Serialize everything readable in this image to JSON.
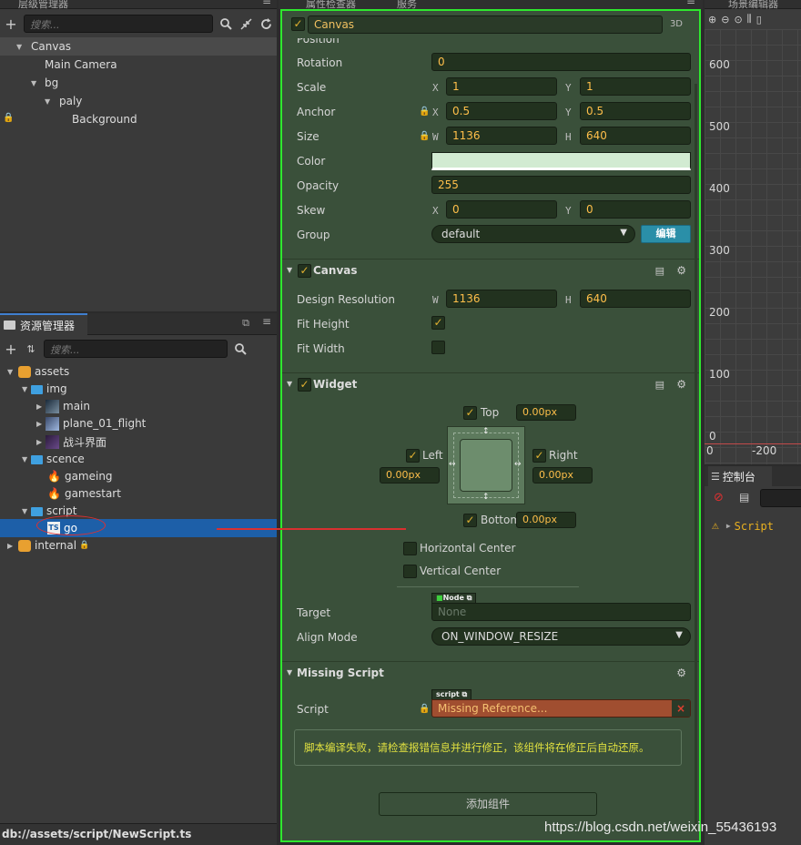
{
  "hierarchy": {
    "title": "层级管理器",
    "search_placeholder": "搜索...",
    "items": [
      "Canvas",
      "Main Camera",
      "bg",
      "paly",
      "Background"
    ]
  },
  "assets": {
    "title": "资源管理器",
    "search_placeholder": "搜索...",
    "items": [
      "assets",
      "img",
      "main",
      "plane_01_flight",
      "战斗界面",
      "scence",
      "gameing",
      "gamestart",
      "script",
      "go",
      "internal"
    ],
    "status_path": "db://assets/script/NewScript.ts"
  },
  "inspector": {
    "tab": "属性检查器",
    "tab2": "服务",
    "node_name": "Canvas",
    "badge_3d": "3D",
    "position_label": "Position",
    "rotation": {
      "label": "Rotation",
      "value": "0"
    },
    "scale": {
      "label": "Scale",
      "x_axis": "X",
      "x": "1",
      "y_axis": "Y",
      "y": "1"
    },
    "anchor": {
      "label": "Anchor",
      "x_axis": "X",
      "x": "0.5",
      "y_axis": "Y",
      "y": "0.5"
    },
    "size": {
      "label": "Size",
      "w_axis": "W",
      "w": "1136",
      "h_axis": "H",
      "h": "640"
    },
    "color": {
      "label": "Color",
      "swatch": "#d2ebd2"
    },
    "opacity": {
      "label": "Opacity",
      "value": "255"
    },
    "skew": {
      "label": "Skew",
      "x_axis": "X",
      "x": "0",
      "y_axis": "Y",
      "y": "0"
    },
    "group": {
      "label": "Group",
      "value": "default",
      "edit_button": "编辑"
    },
    "canvas_comp": {
      "title": "Canvas",
      "design_label": "Design Resolution",
      "w_axis": "W",
      "w": "1136",
      "h_axis": "H",
      "h": "640",
      "fit_height": "Fit Height",
      "fit_width": "Fit Width"
    },
    "widget": {
      "title": "Widget",
      "top": "Top",
      "top_val": "0.00px",
      "left": "Left",
      "left_val": "0.00px",
      "right": "Right",
      "right_val": "0.00px",
      "bottom": "Bottom",
      "bottom_val": "0.00px",
      "hcenter": "Horizontal Center",
      "vcenter": "Vertical Center",
      "target_label": "Target",
      "target_tag": "Node",
      "target_value": "None",
      "align_label": "Align Mode",
      "align_value": "ON_WINDOW_RESIZE"
    },
    "missing": {
      "title": "Missing Script",
      "script_label": "Script",
      "script_tag": "script",
      "script_value": "Missing Reference...",
      "message": "脚本编译失败，请检查报错信息并进行修正，该组件将在修正后自动还原。"
    },
    "add_component": "添加组件"
  },
  "scene": {
    "title": "场景编辑器",
    "y_ticks": [
      "600",
      "500",
      "400",
      "300",
      "200",
      "100",
      "0"
    ],
    "x_ticks": [
      "0",
      "-200"
    ]
  },
  "console": {
    "title": "控制台",
    "entry": "Script"
  },
  "watermark": "https://blog.csdn.net/weixin_55436193"
}
